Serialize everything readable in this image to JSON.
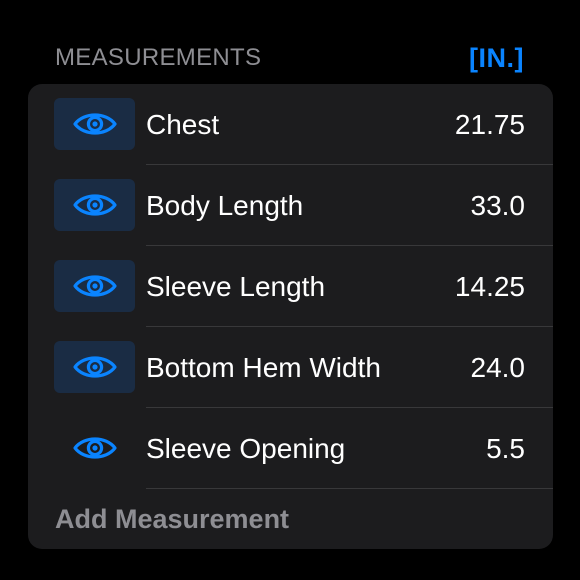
{
  "header": {
    "title": "MEASUREMENTS",
    "unit_label": "[IN.]"
  },
  "colors": {
    "accent": "#0a84ff",
    "card_background": "#1c1c1e",
    "secondary_text": "#8e8e93",
    "active_icon_background": "#1a2c44"
  },
  "measurements": [
    {
      "label": "Chest",
      "value": "21.75",
      "icon": "eye-icon",
      "highlighted": true
    },
    {
      "label": "Body Length",
      "value": "33.0",
      "icon": "eye-icon",
      "highlighted": true
    },
    {
      "label": "Sleeve Length",
      "value": "14.25",
      "icon": "eye-icon",
      "highlighted": true
    },
    {
      "label": "Bottom Hem Width",
      "value": "24.0",
      "icon": "eye-icon",
      "highlighted": true
    },
    {
      "label": "Sleeve Opening",
      "value": "5.5",
      "icon": "eye-icon",
      "highlighted": false
    }
  ],
  "add_button": {
    "label": "Add Measurement"
  }
}
